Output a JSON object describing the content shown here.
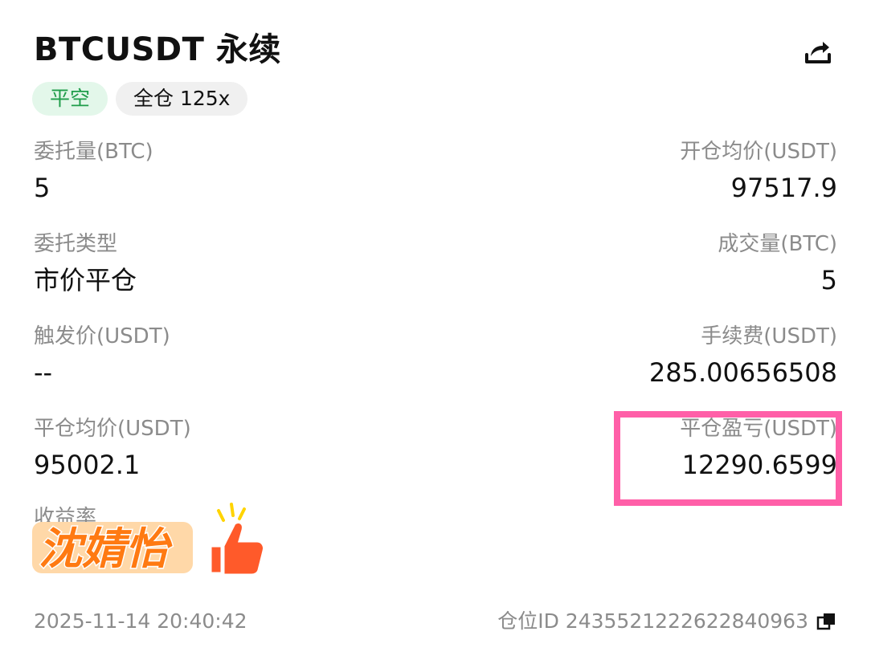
{
  "header": {
    "title": "BTCUSDT 永续",
    "share_icon": "share-icon"
  },
  "tags": {
    "side": "平空",
    "margin_mode": "全仓 125x"
  },
  "colors": {
    "tag_green_text": "#1f9d4a",
    "tag_green_bg": "#e3f7ea",
    "highlight": "#ff5fa8",
    "label_gray": "#8b8b8b"
  },
  "fields": {
    "order_qty": {
      "label": "委托量(BTC)",
      "value": "5"
    },
    "open_avg_price": {
      "label": "开仓均价(USDT)",
      "value": "97517.9"
    },
    "order_type": {
      "label": "委托类型",
      "value": "市价平仓"
    },
    "filled_qty": {
      "label": "成交量(BTC)",
      "value": "5"
    },
    "trigger_price": {
      "label": "触发价(USDT)",
      "value": "--"
    },
    "fee": {
      "label": "手续费(USDT)",
      "value": "285.00656508"
    },
    "close_avg_price": {
      "label": "平仓均价(USDT)",
      "value": "95002.1"
    },
    "close_pnl": {
      "label": "平仓盈亏(USDT)",
      "value": "12290.6599"
    },
    "yield_label": "收益率"
  },
  "sticker": {
    "text": "沈婧怡",
    "icon": "thumbs-up-icon"
  },
  "footer": {
    "timestamp": "2025-11-14 20:40:42",
    "position_id": "仓位ID 2435521222622840963",
    "copy_icon": "copy-icon"
  }
}
